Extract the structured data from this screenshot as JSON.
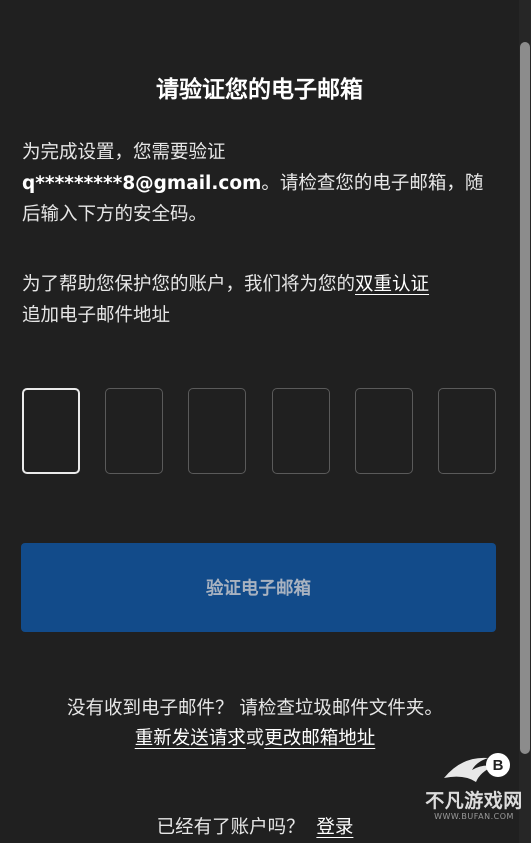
{
  "page": {
    "title": "请验证您的电子邮箱"
  },
  "description": {
    "line1": "为完成设置，您需要验证",
    "email": "q*********8@gmail.com",
    "line2": "。请检查您的电子邮箱，随后输入下方的安全码。",
    "protect_prefix": "为了帮助您保护您的账户，我们将为您的",
    "two_factor_link": "双重认证",
    "protect_suffix": "追加电子邮件地址"
  },
  "code_input": {
    "digits": [
      "",
      "",
      "",
      "",
      "",
      ""
    ],
    "active_index": 0
  },
  "verify_button": {
    "label": "验证电子邮箱"
  },
  "help": {
    "no_email": "没有收到电子邮件？ 请检查垃圾邮件文件夹。",
    "resend_link": "重新发送请求",
    "or_text": "或",
    "change_email_link": "更改邮箱地址"
  },
  "login": {
    "prompt": "已经有了账户吗？",
    "link": "登录"
  },
  "watermark": {
    "text": "不凡游戏网",
    "subtext": "WWW.BUFAN.COM",
    "logo_letter": "B"
  },
  "colors": {
    "background": "#202020",
    "button": "#124b8a",
    "button_text": "#a8b2c0"
  }
}
